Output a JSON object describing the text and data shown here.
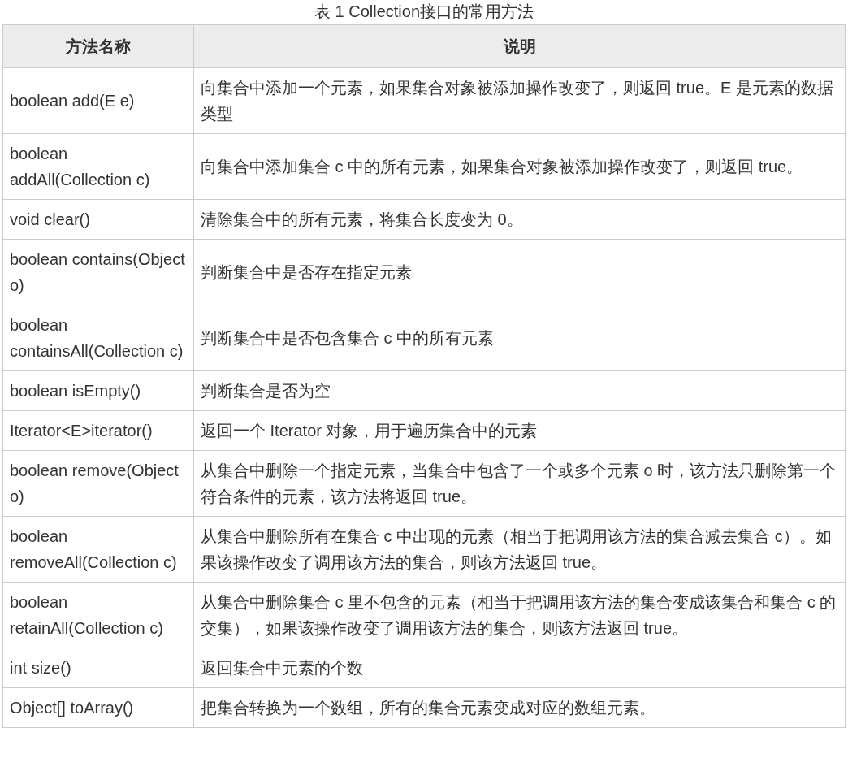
{
  "caption": "表 1 Collection接口的常用方法",
  "table": {
    "columns": [
      "方法名称",
      "说明"
    ],
    "rows": [
      {
        "method": "boolean add(E e)",
        "description": "向集合中添加一个元素，如果集合对象被添加操作改变了，则返回 true。E 是元素的数据类型"
      },
      {
        "method": "boolean addAll(Collection c)",
        "description": "向集合中添加集合 c 中的所有元素，如果集合对象被添加操作改变了，则返回 true。"
      },
      {
        "method": "void clear()",
        "description": "清除集合中的所有元素，将集合长度变为 0。"
      },
      {
        "method": "boolean contains(Object o)",
        "description": "判断集合中是否存在指定元素"
      },
      {
        "method": "boolean containsAll(Collection c)",
        "description": "判断集合中是否包含集合 c 中的所有元素"
      },
      {
        "method": "boolean isEmpty()",
        "description": "判断集合是否为空"
      },
      {
        "method": "Iterator<E>iterator()",
        "description": "返回一个 Iterator 对象，用于遍历集合中的元素"
      },
      {
        "method": "boolean remove(Object o)",
        "description": "从集合中删除一个指定元素，当集合中包含了一个或多个元素 o 时，该方法只删除第一个符合条件的元素，该方法将返回 true。"
      },
      {
        "method": "boolean removeAll(Collection c)",
        "description": "从集合中删除所有在集合 c 中出现的元素（相当于把调用该方法的集合减去集合 c）。如果该操作改变了调用该方法的集合，则该方法返回 true。"
      },
      {
        "method": "boolean retainAll(Collection c)",
        "description": "从集合中删除集合 c 里不包含的元素（相当于把调用该方法的集合变成该集合和集合 c 的交集），如果该操作改变了调用该方法的集合，则该方法返回 true。"
      },
      {
        "method": "int size()",
        "description": "返回集合中元素的个数"
      },
      {
        "method": "Object[] toArray()",
        "description": "把集合转换为一个数组，所有的集合元素变成对应的数组元素。"
      }
    ]
  }
}
